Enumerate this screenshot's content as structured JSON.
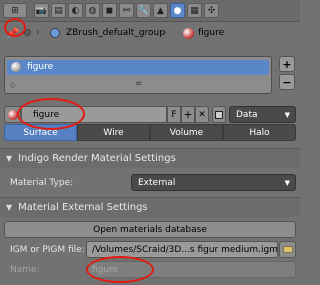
{
  "tabs": [
    {
      "icon": "render-icon"
    },
    {
      "icon": "render-layers-icon"
    },
    {
      "icon": "scene-icon"
    },
    {
      "icon": "world-icon"
    },
    {
      "icon": "object-icon"
    },
    {
      "icon": "constraints-icon"
    },
    {
      "icon": "modifiers-icon"
    },
    {
      "icon": "data-icon"
    },
    {
      "icon": "material-icon",
      "active": true
    },
    {
      "icon": "texture-icon"
    },
    {
      "icon": "particles-icon"
    }
  ],
  "breadcrumb": {
    "group": "ZBrush_defualt_group",
    "arrow": "›",
    "material": "figure"
  },
  "material_list": {
    "items": [
      "figure"
    ],
    "add": "+",
    "remove": "−",
    "grip": "="
  },
  "material_selector": {
    "name": "figure",
    "fake_user": "F",
    "add": "+",
    "unlink": "✕",
    "link_type": "Data"
  },
  "preview_tabs": [
    "Surface",
    "Wire",
    "Volume",
    "Halo"
  ],
  "panel_indigo": {
    "title": "Indigo Render Material Settings",
    "material_type_label": "Material Type:",
    "material_type_value": "External"
  },
  "panel_external": {
    "title": "Material External Settings",
    "open_db_button": "Open materials database",
    "file_label": "IGM or PIGM file:",
    "file_value": "/Volumes/SCraid/3D...s figur medium.igm",
    "name_label": "Name:",
    "name_value": "figure"
  },
  "colors": {
    "accent": "#5a87c8",
    "annotation": "#e21c12"
  }
}
